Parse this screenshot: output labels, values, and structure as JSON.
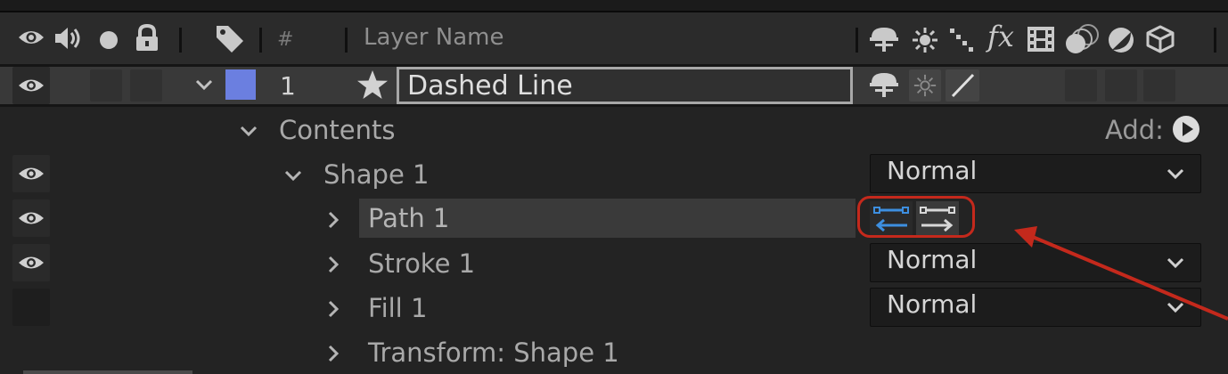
{
  "header": {
    "number_col": "#",
    "name_col": "Layer Name",
    "icons": [
      "eye-icon",
      "speaker-icon",
      "solo-dot-icon",
      "lock-icon",
      "label-tag-icon",
      "shy-icon",
      "collapse-sun-icon",
      "quality-icon",
      "fx-icon",
      "frame-blend-icon",
      "motion-blur-icon",
      "adjustment-icon",
      "3d-cube-icon"
    ]
  },
  "layer": {
    "number": "1",
    "name": "Dashed Line",
    "label_color": "#6b7fe0"
  },
  "tree": {
    "contents": "Contents",
    "add_label": "Add:",
    "shape": "Shape 1",
    "path": "Path 1",
    "stroke": "Stroke 1",
    "fill": "Fill 1",
    "transform": "Transform: Shape 1"
  },
  "dropdowns": {
    "shape_mode": "Normal",
    "stroke_mode": "Normal",
    "fill_mode": "Normal"
  },
  "colors": {
    "panel_bg": "#232323",
    "row_selected": "#393939",
    "highlight_red": "#c4291c",
    "path_icon_blue": "#3d8fe0"
  }
}
